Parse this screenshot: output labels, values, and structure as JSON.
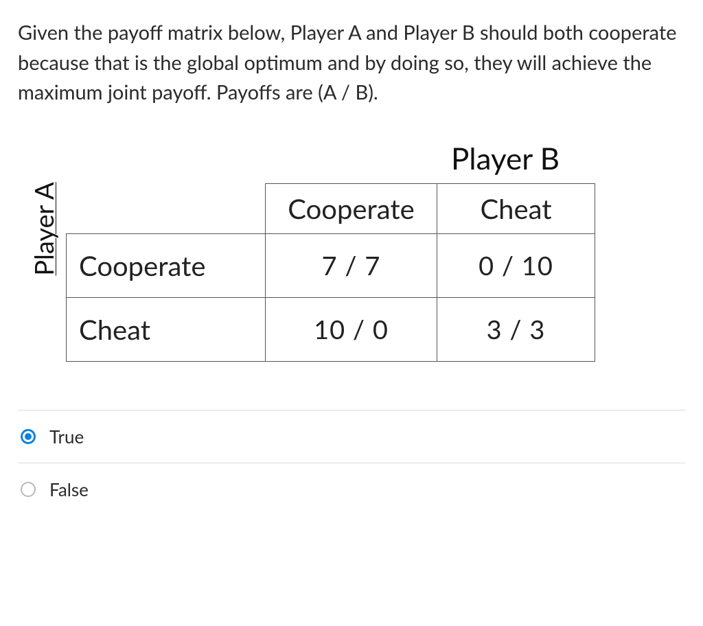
{
  "question": "Given the payoff matrix below, Player A and Player B should both cooperate because that is the global optimum and by doing so, they will achieve the maximum joint payoff. Payoffs are (A / B).",
  "matrix": {
    "player_a_label": "Player A",
    "player_b_label": "Player B",
    "col_headers": [
      "Cooperate",
      "Cheat"
    ],
    "row_headers": [
      "Cooperate",
      "Cheat"
    ],
    "cells": {
      "r0c0": "7 / 7",
      "r0c1": "0 / 10",
      "r1c0": "10 / 0",
      "r1c1": "3 / 3"
    }
  },
  "options": {
    "true_label": "True",
    "false_label": "False",
    "selected": "true"
  },
  "chart_data": {
    "type": "table",
    "title": "Payoff matrix (A / B)",
    "row_axis": "Player A",
    "col_axis": "Player B",
    "columns": [
      "Cooperate",
      "Cheat"
    ],
    "rows": [
      "Cooperate",
      "Cheat"
    ],
    "payoffs": [
      [
        {
          "A": 7,
          "B": 7
        },
        {
          "A": 0,
          "B": 10
        }
      ],
      [
        {
          "A": 10,
          "B": 0
        },
        {
          "A": 3,
          "B": 3
        }
      ]
    ]
  }
}
